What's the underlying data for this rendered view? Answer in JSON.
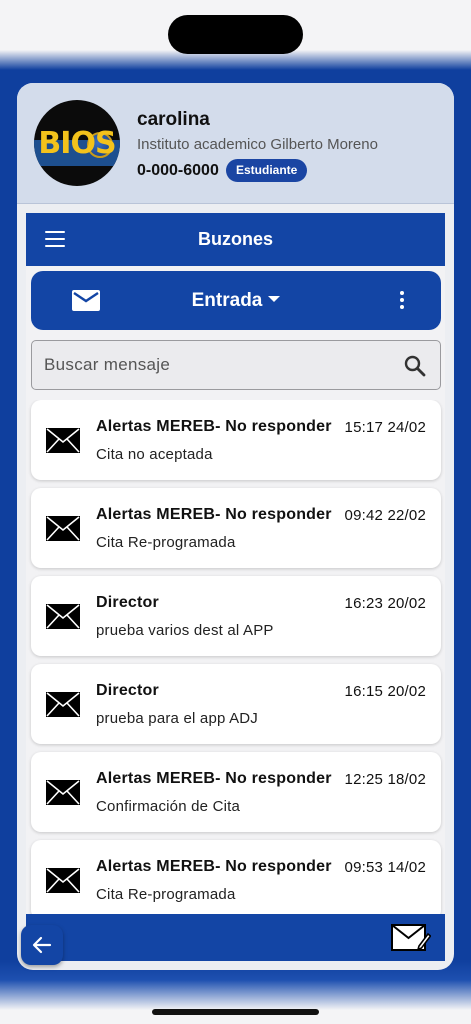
{
  "profile": {
    "logo_text": "BIOS",
    "name": "carolina",
    "institute": "Instituto academico Gilberto Moreno",
    "phone": "0-000-6000",
    "role": "Estudiante"
  },
  "appbar": {
    "title": "Buzones"
  },
  "folder": {
    "selected": "Entrada"
  },
  "search": {
    "placeholder": "Buscar mensaje"
  },
  "messages": [
    {
      "sender": "Alertas MEREB- No responder",
      "time": "15:17 24/02",
      "subject": "Cita no aceptada"
    },
    {
      "sender": "Alertas MEREB- No responder",
      "time": "09:42 22/02",
      "subject": "Cita Re-programada"
    },
    {
      "sender": "Director",
      "time": "16:23 20/02",
      "subject": "prueba varios dest al APP"
    },
    {
      "sender": "Director",
      "time": "16:15 20/02",
      "subject": "prueba para el app ADJ"
    },
    {
      "sender": "Alertas MEREB- No responder",
      "time": "12:25 18/02",
      "subject": "Confirmación de Cita"
    },
    {
      "sender": "Alertas MEREB- No responder",
      "time": "09:53 14/02",
      "subject": "Cita Re-programada"
    }
  ],
  "colors": {
    "primary": "#1345a5",
    "profile_bg": "#d3dceb",
    "badge": "#1a45a3"
  },
  "icons": {
    "menu": "hamburger-menu-icon",
    "folder": "mail-icon",
    "more": "more-vertical-icon",
    "search": "search-icon",
    "message": "envelope-icon",
    "compose": "compose-mail-icon",
    "back": "arrow-left-icon"
  }
}
